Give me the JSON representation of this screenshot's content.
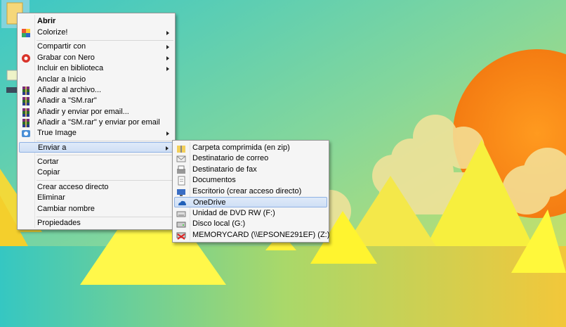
{
  "colors": {
    "menu_bg": "#f5f5f5",
    "highlight": "#cfdff5",
    "highlight_border": "#8fb2e4"
  },
  "context_menu": {
    "items": [
      {
        "label": "Abrir",
        "icon": "none",
        "bold": true
      },
      {
        "label": "Colorize!",
        "icon": "colorize-icon",
        "submenu": true
      },
      {
        "label": "Compartir con",
        "icon": "none",
        "submenu": true
      },
      {
        "label": "Grabar con Nero",
        "icon": "nero-icon",
        "submenu": true
      },
      {
        "label": "Incluir en biblioteca",
        "icon": "none",
        "submenu": true
      },
      {
        "label": "Anclar a Inicio",
        "icon": "none"
      },
      {
        "label": "Añadir al archivo...",
        "icon": "winrar-icon"
      },
      {
        "label": "Añadir a \"SM.rar\"",
        "icon": "winrar-icon"
      },
      {
        "label": "Añadir y enviar por email...",
        "icon": "winrar-icon"
      },
      {
        "label": "Añadir a \"SM.rar\" y enviar por email",
        "icon": "winrar-icon"
      },
      {
        "label": "True Image",
        "icon": "true-image-icon",
        "submenu": true
      },
      {
        "label": "Enviar a",
        "icon": "none",
        "submenu": true,
        "highlighted": true
      },
      {
        "label": "Cortar",
        "icon": "none"
      },
      {
        "label": "Copiar",
        "icon": "none"
      },
      {
        "label": "Crear acceso directo",
        "icon": "none"
      },
      {
        "label": "Eliminar",
        "icon": "none"
      },
      {
        "label": "Cambiar nombre",
        "icon": "none"
      },
      {
        "label": "Propiedades",
        "icon": "none"
      }
    ]
  },
  "send_to_menu": {
    "items": [
      {
        "label": "Carpeta comprimida (en zip)",
        "icon": "zip-folder-icon"
      },
      {
        "label": "Destinatario de correo",
        "icon": "mail-icon"
      },
      {
        "label": "Destinatario de fax",
        "icon": "fax-icon"
      },
      {
        "label": "Documentos",
        "icon": "documents-icon"
      },
      {
        "label": "Escritorio (crear acceso directo)",
        "icon": "desktop-icon"
      },
      {
        "label": "OneDrive",
        "icon": "onedrive-icon",
        "highlighted": true
      },
      {
        "label": "Unidad de DVD RW (F:)",
        "icon": "dvd-drive-icon"
      },
      {
        "label": "Disco local (G:)",
        "icon": "local-disk-icon"
      },
      {
        "label": "MEMORYCARD (\\\\EPSONE291EF) (Z:)",
        "icon": "network-drive-icon"
      }
    ]
  }
}
